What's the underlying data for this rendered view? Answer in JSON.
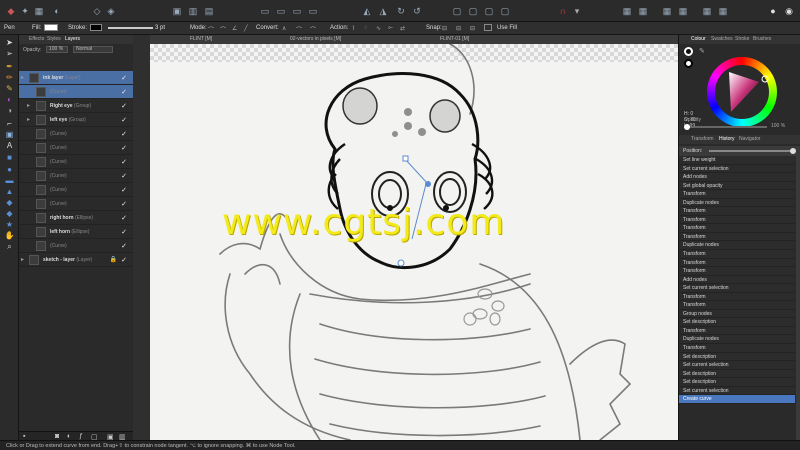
{
  "context_bar": {
    "tool_name": "Pen",
    "fill_label": "Fill:",
    "stroke_label": "Stroke:",
    "stroke_width": "3 pt",
    "mode_label": "Mode:",
    "convert_label": "Convert:",
    "action_label": "Action:",
    "snap_label": "Snap:",
    "use_fill_label": "Use Fill"
  },
  "document_tabs": [
    "FLINT [M]",
    "02-vectors in pixels [M]",
    "FLINT-01 [M]"
  ],
  "layers_panel": {
    "tabs": [
      "Effects",
      "Styles",
      "Layers"
    ],
    "opacity_label": "Opacity:",
    "opacity_value": "100 %",
    "blend_mode": "Normal",
    "rows": [
      {
        "name": "ink layer",
        "type": "(Layer)",
        "level": 0,
        "expander": true,
        "selected": true
      },
      {
        "name": "",
        "type": "(Curve)",
        "level": 1,
        "selected": true
      },
      {
        "name": "Right eye",
        "type": "(Group)",
        "level": 1,
        "expander": true
      },
      {
        "name": "left  eye",
        "type": "(Group)",
        "level": 1,
        "expander": true
      },
      {
        "name": "",
        "type": "(Curve)",
        "level": 1
      },
      {
        "name": "",
        "type": "(Curve)",
        "level": 1
      },
      {
        "name": "",
        "type": "(Curve)",
        "level": 1
      },
      {
        "name": "",
        "type": "(Curve)",
        "level": 1
      },
      {
        "name": "",
        "type": "(Curve)",
        "level": 1
      },
      {
        "name": "",
        "type": "(Curve)",
        "level": 1
      },
      {
        "name": "right horn",
        "type": "(Ellipse)",
        "level": 1
      },
      {
        "name": "left horn",
        "type": "(Ellipse)",
        "level": 1
      },
      {
        "name": "",
        "type": "(Curve)",
        "level": 1
      },
      {
        "name": "sketch - layer",
        "type": "(Layer)",
        "level": 0,
        "expander": true,
        "locked": true
      }
    ]
  },
  "canvas": {
    "watermark": "www.cgtsj.com"
  },
  "colour_panel": {
    "tabs": [
      "Colour",
      "Swatches",
      "Stroke",
      "Brushes"
    ],
    "hsl": [
      "H: 0",
      "S: 70",
      "L: 99"
    ],
    "opacity_label": "Opacity",
    "opacity_value": "100 %",
    "accent": "#c8337a"
  },
  "history_panel": {
    "tabs": [
      "Transform",
      "History",
      "Navigator"
    ],
    "position_label": "Position:",
    "items": [
      "Set line weight",
      "Set current selection",
      "Add nodes",
      "Set global opacity",
      "Transform",
      "Duplicate nodes",
      "Transform",
      "Transform",
      "Transform",
      "Transform",
      "Duplicate nodes",
      "Transform",
      "Transform",
      "Transform",
      "Add nodes",
      "Set current selection",
      "Transform",
      "Transform",
      "Group nodes",
      "Set description",
      "Transform",
      "Duplicate nodes",
      "Transform",
      "Set description",
      "Set current selection",
      "Set description",
      "Set description",
      "Set current selection",
      "Create curve"
    ],
    "selected_index": 28
  },
  "status_bar": {
    "text": "Click or Drag to extend curve from end. Drag+⇧ to constrain node tangent. ⌥ to ignore snapping. ⌘ to use Node Tool."
  }
}
